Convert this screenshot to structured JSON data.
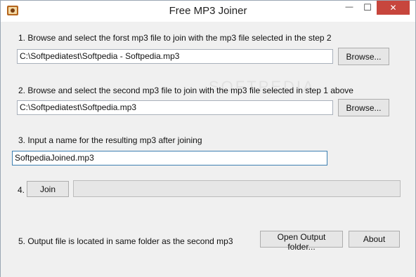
{
  "window": {
    "title": "Free MP3 Joiner",
    "close_glyph": "✕",
    "min_glyph": "—",
    "max_glyph": "☐"
  },
  "step1": {
    "label": "1. Browse and select the forst mp3 file to join  with the mp3 file selected in the step 2",
    "path": "C:\\Softpediatest\\Softpedia - Softpedia.mp3",
    "browse_label": "Browse..."
  },
  "step2": {
    "label": "2. Browse and select the second mp3 file to join with the mp3 file selected in step 1 above",
    "path": "C:\\Softpediatest\\Softpedia.mp3",
    "browse_label": "Browse..."
  },
  "step3": {
    "label": "3. Input  a name for the resulting mp3 after joining",
    "filename": "SoftpediaJoined.mp3"
  },
  "step4": {
    "number": "4.",
    "join_label": "Join",
    "progress": 0
  },
  "step5": {
    "label": "5. Output file is located in same folder as the second  mp3",
    "open_output_label": "Open Output folder...",
    "about_label": "About"
  },
  "watermark": "SOFTPEDIA",
  "colors": {
    "close_button": "#c7463d",
    "focus_border": "#3c7fb1",
    "progress_fill": "#06b025"
  }
}
